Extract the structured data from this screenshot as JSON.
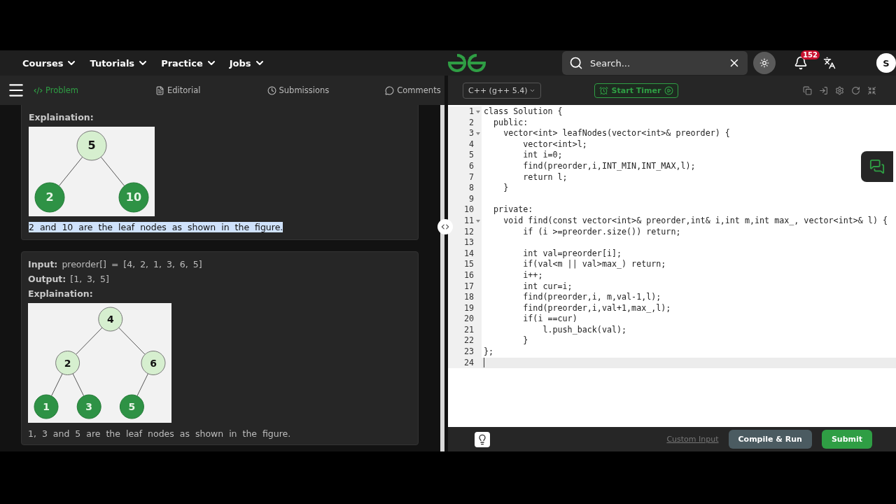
{
  "header": {
    "nav": [
      {
        "label": "Courses"
      },
      {
        "label": "Tutorials"
      },
      {
        "label": "Practice"
      },
      {
        "label": "Jobs"
      }
    ],
    "search": {
      "placeholder": "Search..."
    },
    "notifications": "152",
    "avatar": "S"
  },
  "problem_tabs": [
    {
      "label": "Problem",
      "selected": true
    },
    {
      "label": "Editorial",
      "selected": false
    },
    {
      "label": "Submissions",
      "selected": false
    },
    {
      "label": "Comments",
      "selected": false
    }
  ],
  "examples": [
    {
      "explanation_label": "Explaination:",
      "tree": {
        "value": "5",
        "highlighted": false,
        "children": [
          {
            "value": "2",
            "highlighted": true
          },
          {
            "value": "10",
            "highlighted": true
          }
        ]
      },
      "caption": "2 and 10 are the leaf nodes as shown in the figure.",
      "caption_selected": true
    },
    {
      "input_label": "Input:",
      "input": "preorder[] = [4, 2, 1, 3, 6, 5]",
      "output_label": "Output:",
      "output": "[1, 3, 5]",
      "explanation_label": "Explaination:",
      "tree": {
        "value": "4",
        "highlighted": false,
        "children": [
          {
            "value": "2",
            "highlighted": false,
            "children": [
              {
                "value": "1",
                "highlighted": true
              },
              {
                "value": "3",
                "highlighted": true
              }
            ]
          },
          {
            "value": "6",
            "highlighted": false,
            "children": [
              {
                "value": "5",
                "highlighted": true
              }
            ]
          }
        ]
      },
      "caption": "1, 3 and 5 are the leaf nodes as shown in the figure.",
      "caption_selected": false
    }
  ],
  "editor": {
    "language": "C++ (g++ 5.4)",
    "timer": "Start Timer",
    "lines": [
      {
        "number": "1",
        "code": "class Solution {",
        "foldable": true,
        "current": false
      },
      {
        "number": "2",
        "code": "  public:",
        "foldable": false,
        "current": false
      },
      {
        "number": "3",
        "code": "    vector<int> leafNodes(vector<int>& preorder) {",
        "foldable": true,
        "current": false
      },
      {
        "number": "4",
        "code": "        vector<int>l;",
        "foldable": false,
        "current": false
      },
      {
        "number": "5",
        "code": "        int i=0;",
        "foldable": false,
        "current": false
      },
      {
        "number": "6",
        "code": "        find(preorder,i,INT_MIN,INT_MAX,l);",
        "foldable": false,
        "current": false
      },
      {
        "number": "7",
        "code": "        return l;",
        "foldable": false,
        "current": false
      },
      {
        "number": "8",
        "code": "    }",
        "foldable": false,
        "current": false
      },
      {
        "number": "9",
        "foldable": false,
        "current": false
      },
      {
        "number": "10",
        "code": "  private:",
        "foldable": false,
        "current": false
      },
      {
        "number": "11",
        "code": "    void find(const vector<int>& preorder,int& i,int m,int max_, vector<int>& l) {",
        "foldable": true,
        "current": false
      },
      {
        "number": "12",
        "code": "        if (i >=preorder.size()) return;",
        "foldable": false,
        "current": false
      },
      {
        "number": "13",
        "foldable": false,
        "current": false
      },
      {
        "number": "14",
        "code": "        int val=preorder[i];",
        "foldable": false,
        "current": false
      },
      {
        "number": "15",
        "code": "        if(val<m || val>max_) return;",
        "foldable": false,
        "current": false
      },
      {
        "number": "16",
        "code": "        i++;",
        "foldable": false,
        "current": false
      },
      {
        "number": "17",
        "code": "        int cur=i;",
        "foldable": false,
        "current": false
      },
      {
        "number": "18",
        "code": "        find(preorder,i, m,val-1,l);",
        "foldable": false,
        "current": false
      },
      {
        "number": "19",
        "code": "        find(preorder,i,val+1,max_,l);",
        "foldable": false,
        "current": false
      },
      {
        "number": "20",
        "code": "        if(i ==cur)",
        "foldable": false,
        "current": false
      },
      {
        "number": "21",
        "code": "            l.push_back(val);",
        "foldable": false,
        "current": false
      },
      {
        "number": "22",
        "code": "        }",
        "foldable": false,
        "current": false
      },
      {
        "number": "23",
        "code": "};",
        "foldable": false,
        "current": false
      },
      {
        "number": "24",
        "foldable": false,
        "current": true
      }
    ]
  },
  "footer": {
    "custom_input": "Custom Input",
    "run": "Compile & Run",
    "submit": "Submit"
  }
}
